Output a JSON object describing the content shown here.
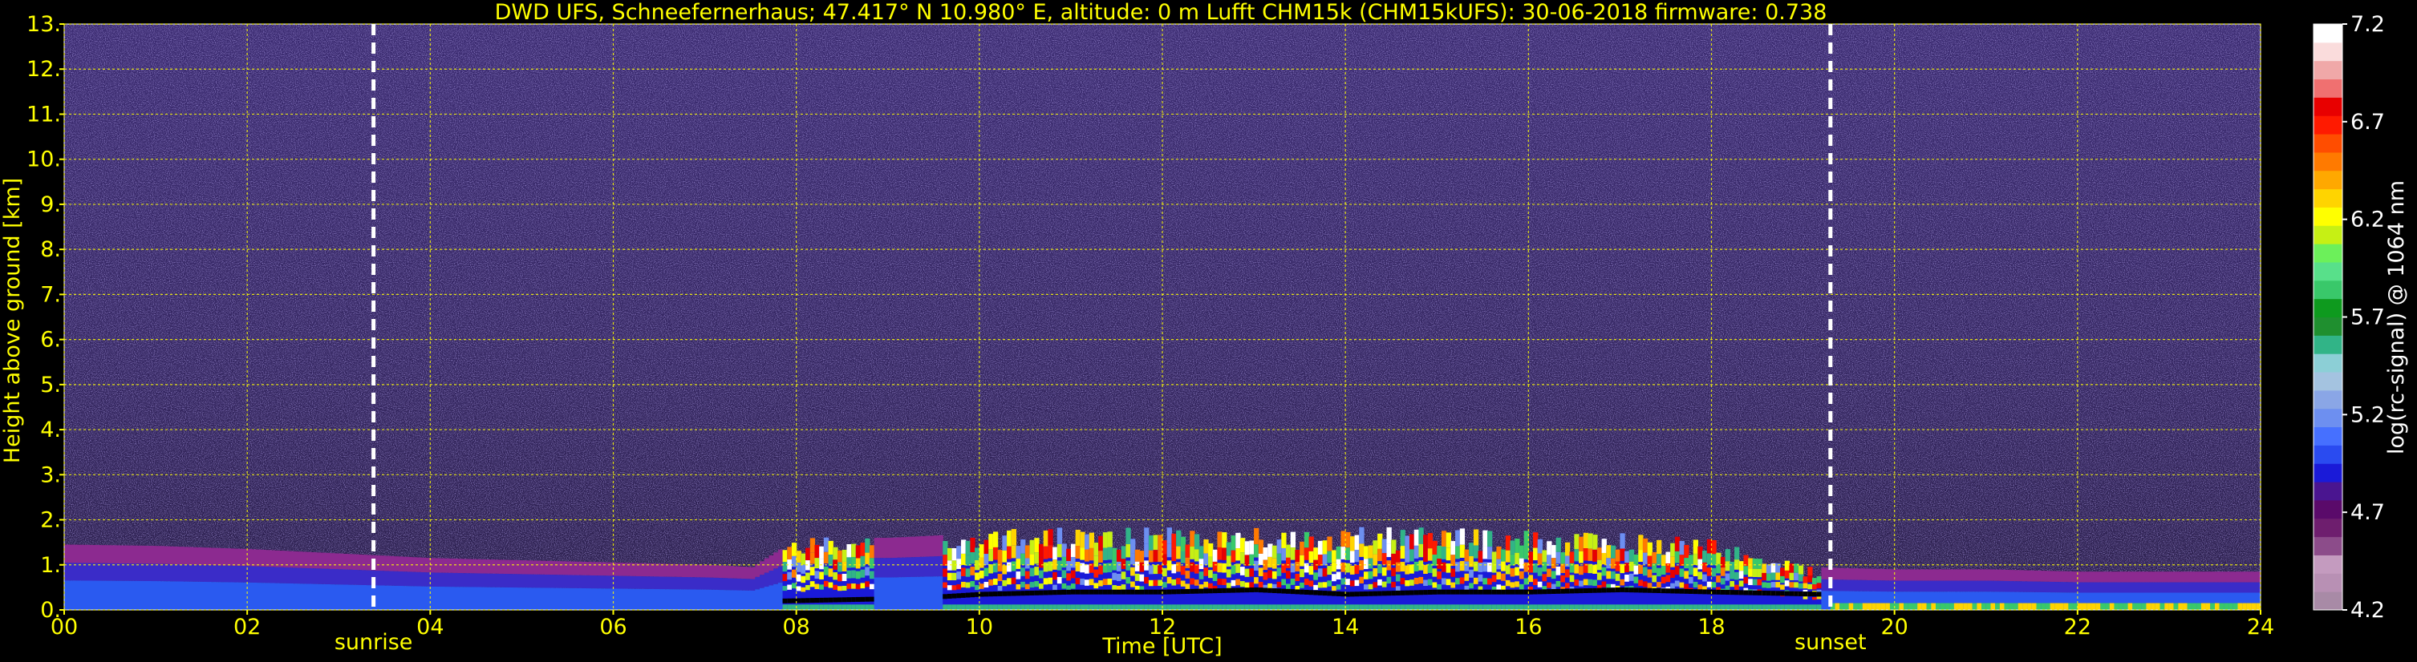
{
  "chart_data": {
    "type": "heatmap",
    "title": "DWD UFS, Schneefernerhaus; 47.417° N 10.980° E, altitude: 0 m    Lufft CHM15k (CHM15kUFS): 30-06-2018    firmware: 0.738",
    "xlabel": "Time [UTC]",
    "ylabel": "Height above ground [km]",
    "xlim": [
      0,
      24
    ],
    "ylim": [
      0,
      13
    ],
    "x_ticks": [
      "00",
      "02",
      "04",
      "06",
      "08",
      "10",
      "12",
      "14",
      "16",
      "18",
      "20",
      "22",
      "24"
    ],
    "y_ticks": [
      "0.",
      "1.",
      "2.",
      "3.",
      "4.",
      "5.",
      "6.",
      "7.",
      "8.",
      "9.",
      "10.",
      "11.",
      "12.",
      "13."
    ],
    "grid": true,
    "markers": [
      {
        "label": "sunrise",
        "time": 3.38
      },
      {
        "label": "sunset",
        "time": 19.3
      }
    ],
    "colorbar": {
      "label": "log(rc-signal) @ 1064 nm",
      "range": [
        4.2,
        7.2
      ],
      "ticks": [
        "4.2",
        "4.7",
        "5.2",
        "5.7",
        "6.2",
        "6.7",
        "7.2"
      ],
      "colors": [
        "#a88aa6",
        "#b890b4",
        "#c49bbf",
        "#8c4c8a",
        "#6e1e6e",
        "#5a0a6a",
        "#4a1590",
        "#1a1ad8",
        "#2a4bf0",
        "#4670ff",
        "#6d8ff0",
        "#8aa6e6",
        "#a4c3e0",
        "#8ccfd6",
        "#31b487",
        "#1f8f2f",
        "#0e9a1e",
        "#39c86a",
        "#58e08a",
        "#6cf05a",
        "#c6f014",
        "#ffff00",
        "#ffd400",
        "#ffa800",
        "#ff7a00",
        "#ff4d00",
        "#ff1a00",
        "#e80000",
        "#f07070",
        "#f0a8a8",
        "#fadcdc",
        "#ffffff"
      ]
    },
    "series": [
      {
        "kind": "boundary_layer_top_km",
        "times": [
          0,
          1,
          2,
          3,
          4,
          5,
          6,
          7,
          7.5,
          8,
          9,
          10,
          11,
          12,
          13,
          14,
          15,
          16,
          17,
          18,
          19,
          20,
          21,
          22,
          23,
          24
        ],
        "values": [
          1.45,
          1.42,
          1.35,
          1.25,
          1.15,
          1.1,
          1.05,
          1.0,
          0.95,
          1.6,
          1.6,
          1.7,
          1.75,
          1.75,
          1.75,
          1.75,
          1.75,
          1.7,
          1.65,
          1.5,
          0.95,
          0.9,
          0.9,
          0.85,
          0.85,
          0.85
        ]
      },
      {
        "kind": "cloud_base_km",
        "times": [
          7.8,
          9,
          9.6,
          10,
          11,
          12,
          13,
          14,
          15,
          16,
          17,
          18,
          19.2
        ],
        "values": [
          0.2,
          0.25,
          0.3,
          0.35,
          0.4,
          0.4,
          0.45,
          0.35,
          0.4,
          0.4,
          0.45,
          0.4,
          0.35
        ]
      }
    ]
  }
}
